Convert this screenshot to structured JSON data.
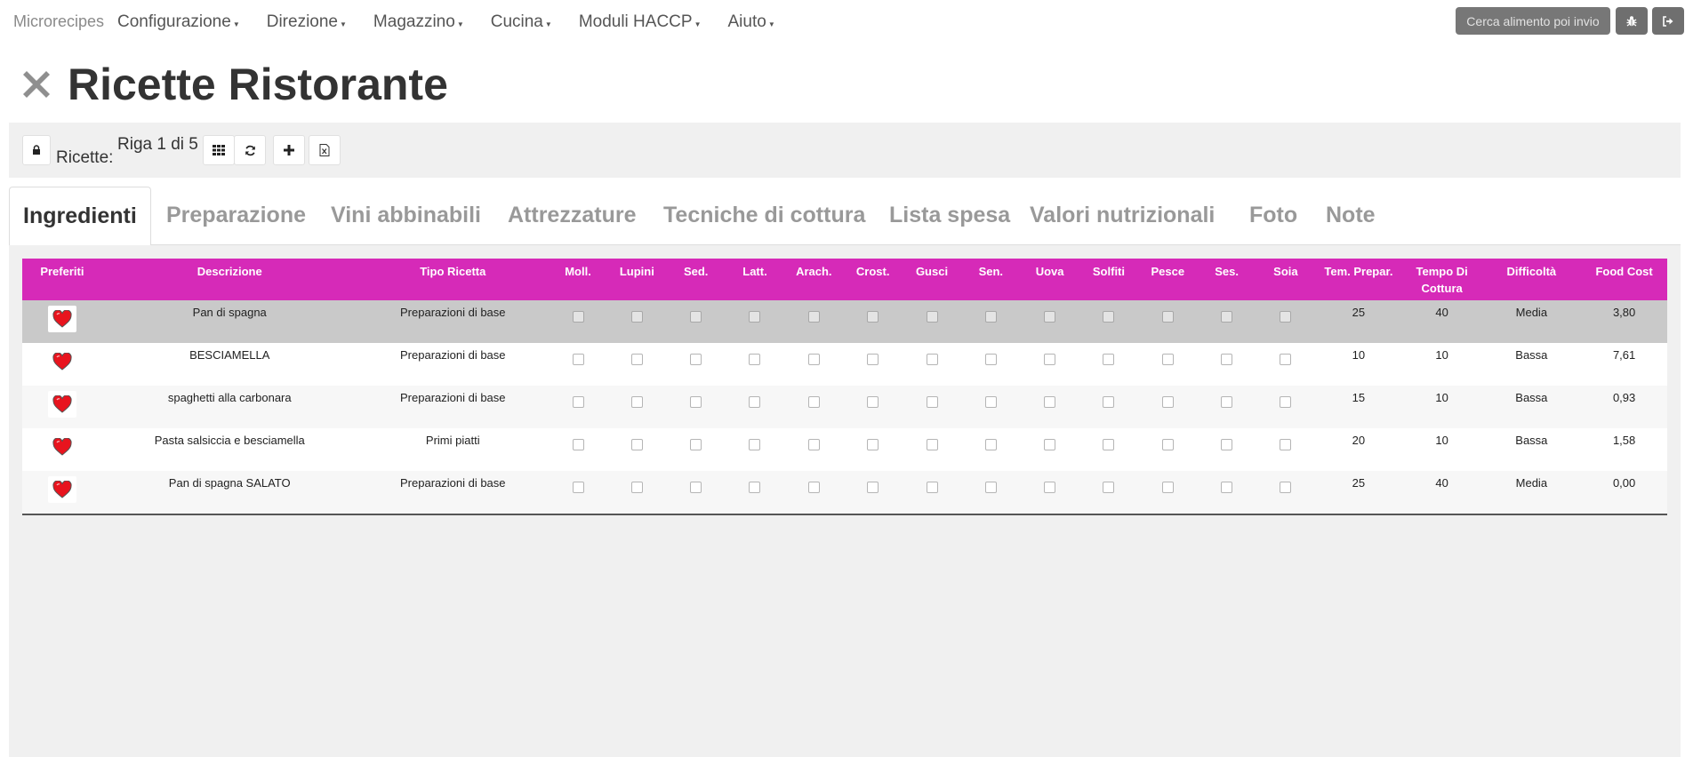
{
  "navbar": {
    "brand": "Microrecipes",
    "menu": [
      "Configurazione",
      "Direzione",
      "Magazzino",
      "Cucina",
      "Moduli HACCP",
      "Aiuto"
    ],
    "search_label": "Cerca alimento poi invio",
    "bug_icon": "bug-icon",
    "logout_icon": "sign-out-icon"
  },
  "page": {
    "title": "Ricette Ristorante",
    "title_icon": "close-x-icon"
  },
  "toolbar": {
    "label": "Ricette:",
    "count": "Riga 1 di 5",
    "icons": [
      "lock-icon",
      "grid-icon",
      "refresh-icon",
      "plus-icon",
      "excel-file-icon"
    ]
  },
  "tabs": [
    "Ingredienti",
    "Preparazione",
    "Vini abbinabili",
    "Attrezzature",
    "Tecniche di cottura",
    "Lista spesa",
    "Valori nutrizionali",
    "Foto",
    "Note"
  ],
  "active_tab": "Ingredienti",
  "colors": {
    "header": "#d62ab8",
    "selected_row": "#c9c9c9",
    "heart": "#e8141e"
  },
  "table": {
    "columns": {
      "preferiti": "Preferiti",
      "descrizione": "Descrizione",
      "tipo": "Tipo Ricetta",
      "allergens": [
        "Moll.",
        "Lupini",
        "Sed.",
        "Latt.",
        "Arach.",
        "Crost.",
        "Gusci",
        "Sen.",
        "Uova",
        "Solfiti",
        "Pesce",
        "Ses.",
        "Soia"
      ],
      "tem_prepar": "Tem. Prepar.",
      "tempo_cottura": "Tempo Di Cottura",
      "difficolta": "Difficoltà",
      "food_cost": "Food Cost"
    },
    "rows": [
      {
        "descrizione": "Pan di spagna",
        "tipo": "Preparazioni di base",
        "tem_prepar": "25",
        "tempo_cottura": "40",
        "difficolta": "Media",
        "food_cost": "3,80"
      },
      {
        "descrizione": "BESCIAMELLA",
        "tipo": "Preparazioni di base",
        "tem_prepar": "10",
        "tempo_cottura": "10",
        "difficolta": "Bassa",
        "food_cost": "7,61"
      },
      {
        "descrizione": "spaghetti alla carbonara",
        "tipo": "Preparazioni di base",
        "tem_prepar": "15",
        "tempo_cottura": "10",
        "difficolta": "Bassa",
        "food_cost": "0,93"
      },
      {
        "descrizione": "Pasta salsiccia e besciamella",
        "tipo": "Primi piatti",
        "tem_prepar": "20",
        "tempo_cottura": "10",
        "difficolta": "Bassa",
        "food_cost": "1,58"
      },
      {
        "descrizione": "Pan di spagna SALATO",
        "tipo": "Preparazioni di base",
        "tem_prepar": "25",
        "tempo_cottura": "40",
        "difficolta": "Media",
        "food_cost": "0,00"
      }
    ]
  }
}
